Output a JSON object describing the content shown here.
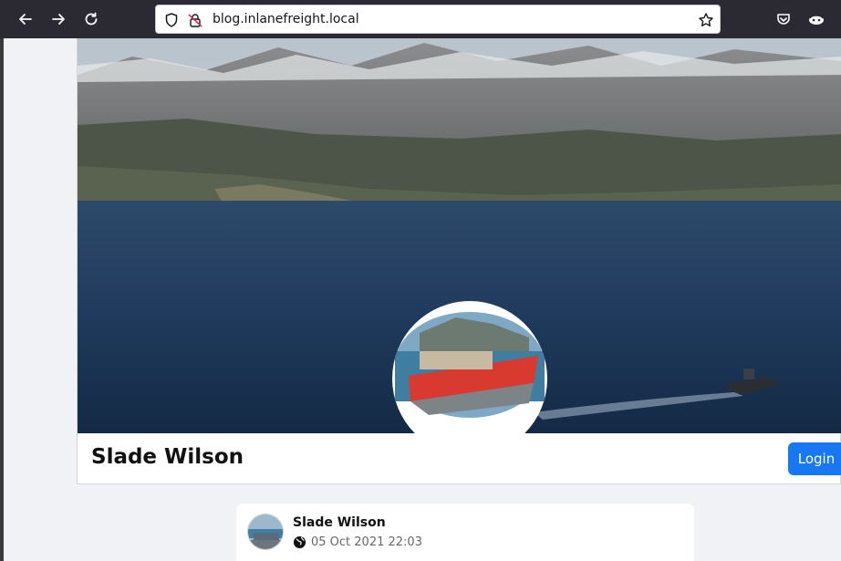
{
  "browser": {
    "url": "blog.inlanefreight.local",
    "icons": [
      "back-icon",
      "forward-icon",
      "reload-icon",
      "shield-icon",
      "insecure-lock-icon",
      "bookmark-star-icon",
      "pocket-icon",
      "extension-icon"
    ]
  },
  "profile": {
    "name": "Slade Wilson",
    "login_label": "Login"
  },
  "post": {
    "author": "Slade Wilson",
    "date": "05 Oct 2021 22:03",
    "visibility_icon": "globe-icon"
  },
  "colors": {
    "accent": "#1877f2",
    "toolbar": "#2b2a33",
    "page_bg": "#f0f2f5"
  }
}
